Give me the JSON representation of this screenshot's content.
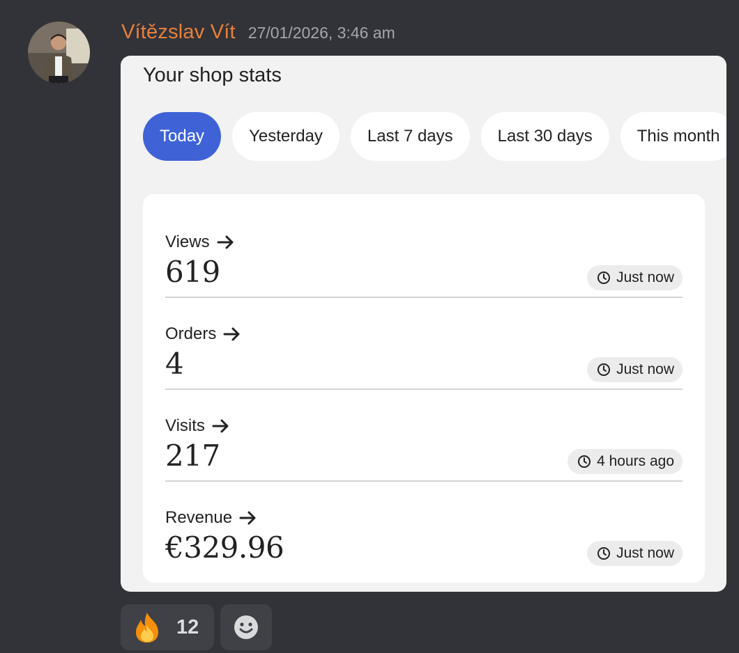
{
  "message": {
    "username": "Vítězslav Vít",
    "timestamp": "27/01/2026, 3:46 am",
    "avatar_icon": "user-avatar-photo"
  },
  "card": {
    "title": "Your shop stats",
    "tabs": [
      {
        "label": "Today",
        "active": true
      },
      {
        "label": "Yesterday",
        "active": false
      },
      {
        "label": "Last 7 days",
        "active": false
      },
      {
        "label": "Last 30 days",
        "active": false
      },
      {
        "label": "This month",
        "active": false
      }
    ],
    "stats": [
      {
        "label": "Views",
        "value": "619",
        "updated": "Just now"
      },
      {
        "label": "Orders",
        "value": "4",
        "updated": "Just now"
      },
      {
        "label": "Visits",
        "value": "217",
        "updated": "4 hours ago"
      },
      {
        "label": "Revenue",
        "value": "€329.96",
        "updated": "Just now"
      }
    ],
    "accent_color": "#3f63d6",
    "icons": {
      "label_arrow": "arrow-right-icon",
      "badge": "clock-icon"
    }
  },
  "reactions": {
    "fire": {
      "emoji": "fire-icon",
      "count": "12"
    },
    "add": {
      "icon": "add-reaction-icon"
    }
  },
  "colors": {
    "background": "#313338",
    "username": "#e8803c",
    "timestamp": "#a3a6ad",
    "card": "#f1f2f1"
  }
}
